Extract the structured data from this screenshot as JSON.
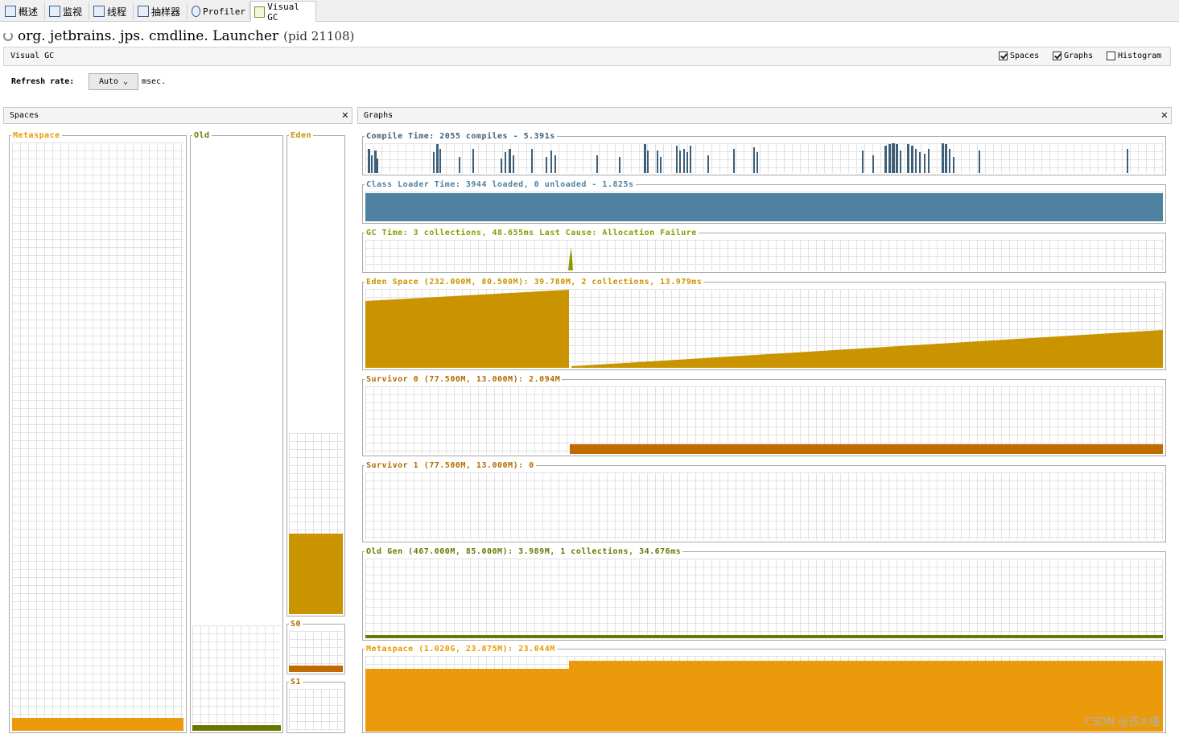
{
  "tabs": [
    {
      "label": "概述",
      "icon": "overview-icon",
      "active": false
    },
    {
      "label": "监视",
      "icon": "monitor-icon",
      "active": false
    },
    {
      "label": "线程",
      "icon": "threads-icon",
      "active": false
    },
    {
      "label": "抽样器",
      "icon": "sampler-icon",
      "active": false
    },
    {
      "label": "Profiler",
      "icon": "profiler-icon",
      "active": false
    },
    {
      "label": "Visual GC",
      "icon": "visual-gc-icon",
      "active": true
    }
  ],
  "app": {
    "title": "org. jetbrains. jps. cmdline. Launcher",
    "pid": "(pid 21108)"
  },
  "toolbar": {
    "label": "Visual GC",
    "spaces": {
      "label": "Spaces",
      "checked": true
    },
    "graphs": {
      "label": "Graphs",
      "checked": true
    },
    "histogram": {
      "label": "Histogram",
      "checked": false
    }
  },
  "refresh": {
    "label": "Refresh rate:",
    "value": "Auto",
    "unit": "msec."
  },
  "spaces_panel": {
    "title": "Spaces",
    "metaspace": {
      "label": "Metaspace",
      "fill": 0.022
    },
    "old": {
      "label": "Old",
      "fill": 0.009
    },
    "eden": {
      "label": "Eden",
      "fill": 0.17
    },
    "s0": {
      "label": "S0",
      "fill": 0.16
    },
    "s1": {
      "label": "S1",
      "fill": 0
    }
  },
  "graphs_panel": {
    "title": "Graphs",
    "compile": {
      "label": "Compile Time: 2055 compiles - 5.391s",
      "color": "#3e5f78"
    },
    "classloader": {
      "label": "Class Loader Time: 3944 loaded, 0 unloaded - 1.825s",
      "color": "#4f82a0"
    },
    "gc": {
      "label": "GC Time: 3 collections, 48.655ms Last Cause: Allocation Failure",
      "color": "#8c9a00"
    },
    "eden": {
      "label": "Eden Space (232.000M, 80.500M): 39.780M, 2 collections, 13.979ms",
      "color": "#c99400"
    },
    "survivor0": {
      "label": "Survivor 0 (77.500M, 13.000M): 2.094M",
      "color": "#c06a00"
    },
    "survivor1": {
      "label": "Survivor 1 (77.500M, 13.000M): 0",
      "color": "#c06a00"
    },
    "oldgen": {
      "label": "Old Gen (467.000M, 85.000M): 3.989M, 1 collections, 34.676ms",
      "color": "#6b7800"
    },
    "metaspace": {
      "label": "Metaspace (1.020G, 23.875M): 23.044M",
      "color": "#ea9a0b"
    }
  },
  "watermark": "CSDN @苏木槿"
}
